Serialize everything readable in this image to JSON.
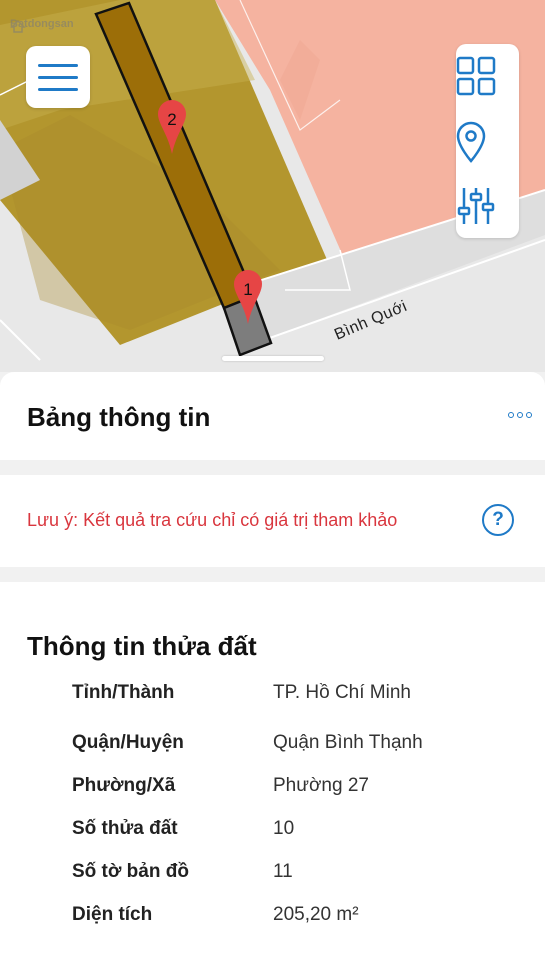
{
  "map": {
    "logo_text": "Batdongsan",
    "street_label": "Bình Quới",
    "pins": [
      "2",
      "1"
    ]
  },
  "icons": {
    "menu": "hamburger-menu-icon",
    "layers": "grid-icon",
    "location": "location-pin-icon",
    "filters": "sliders-icon",
    "more": "more-dots-icon",
    "help": "question-circle-icon"
  },
  "info_panel": {
    "title": "Bảng thông tin"
  },
  "notice": {
    "text": "Lưu ý: Kết quả tra cứu chỉ có giá trị tham khảo",
    "help_symbol": "?"
  },
  "parcel": {
    "title": "Thông tin thửa đất",
    "rows": [
      {
        "label": "Tỉnh/Thành",
        "value": "TP. Hồ Chí Minh"
      },
      {
        "label": "Quận/Huyện",
        "value": "Quận Bình Thạnh"
      },
      {
        "label": "Phường/Xã",
        "value": "Phường 27"
      },
      {
        "label": "Số thửa đất",
        "value": "10"
      },
      {
        "label": "Số tờ bản đồ",
        "value": "11"
      },
      {
        "label": "Diện tích",
        "value": "205,20 m²"
      }
    ]
  },
  "colors": {
    "accent": "#1f7ac7",
    "warning": "#d9363e",
    "parcel_fill": "#9c6e08",
    "zone_fill": "#b3962e",
    "residential": "#f5b3a0"
  }
}
